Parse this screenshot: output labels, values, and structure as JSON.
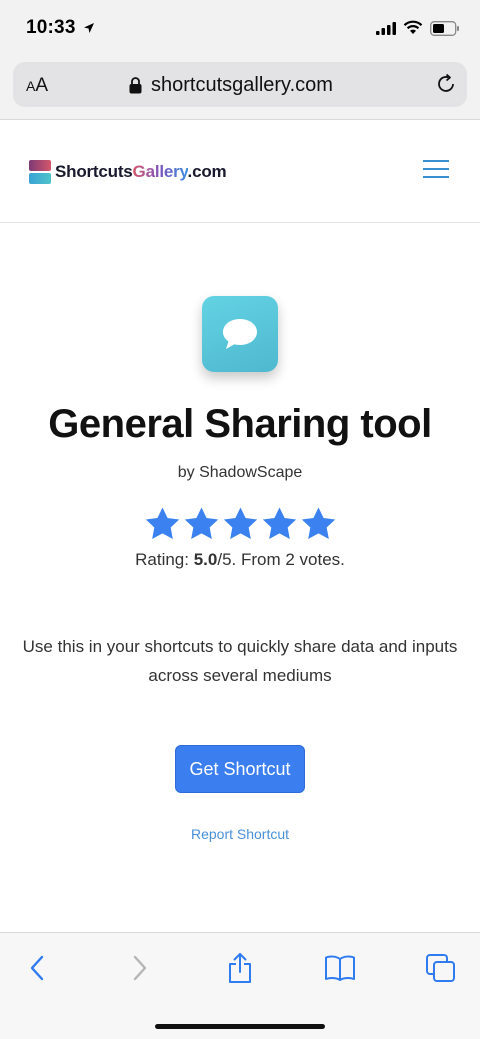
{
  "status_bar": {
    "time": "10:33"
  },
  "browser": {
    "text_size_small": "A",
    "text_size_big": "A",
    "url": "shortcutsgallery.com"
  },
  "site_header": {
    "logo_part1": "Shortcuts",
    "logo_part2": "Gallery",
    "logo_part3": ".com"
  },
  "shortcut": {
    "title": "General Sharing tool",
    "author": "by ShadowScape",
    "rating_prefix": "Rating: ",
    "rating_value": "5.0",
    "rating_suffix": "/5. From 2 votes.",
    "stars": 5,
    "description": "Use this in your shortcuts to quickly share data and inputs across several mediums",
    "get_button": "Get Shortcut",
    "report_link": "Report Shortcut"
  },
  "colors": {
    "accent": "#3b7ef0",
    "star": "#3b82f0",
    "link": "#4a90d9",
    "icon_bg": "#55c4d9"
  },
  "icons": {
    "app_icon": "speech-bubble-icon",
    "menu": "hamburger-icon",
    "toolbar": [
      "back-icon",
      "forward-icon",
      "share-icon",
      "bookmarks-icon",
      "tabs-icon"
    ]
  }
}
